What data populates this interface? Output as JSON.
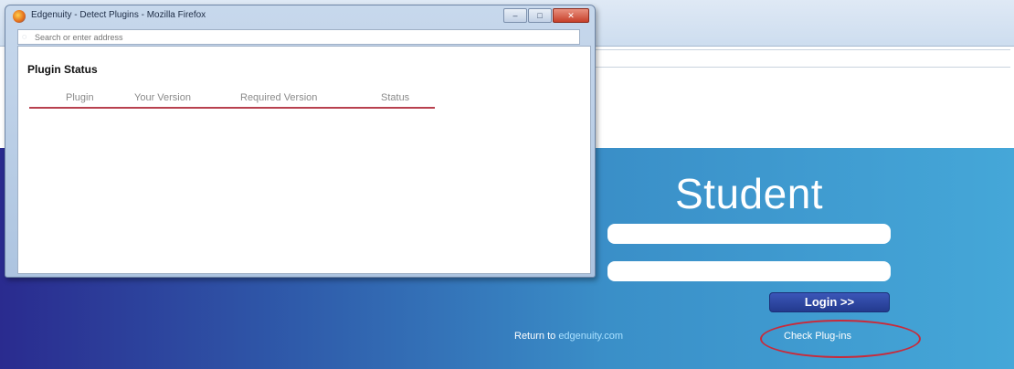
{
  "popup": {
    "title": "Edgenuity - Detect Plugins - Mozilla Firefox",
    "url_placeholder": "Search or enter address",
    "controls": {
      "minimize": "–",
      "maximize": "□",
      "close": "✕"
    },
    "heading": "Plugin Status",
    "table_columns": [
      "Plugin",
      "Your Version",
      "Required Version",
      "Status"
    ]
  },
  "login": {
    "title": "Student",
    "username_value": "",
    "password_value": "",
    "login_button": "Login >>",
    "return_prefix": "Return to ",
    "return_link": "edgenuity.com",
    "check_plugins": "Check Plug-ins"
  },
  "colors": {
    "annotation_circle": "#c92a3a",
    "table_header_rule": "#b8414f",
    "login_button": "#233a8e"
  }
}
